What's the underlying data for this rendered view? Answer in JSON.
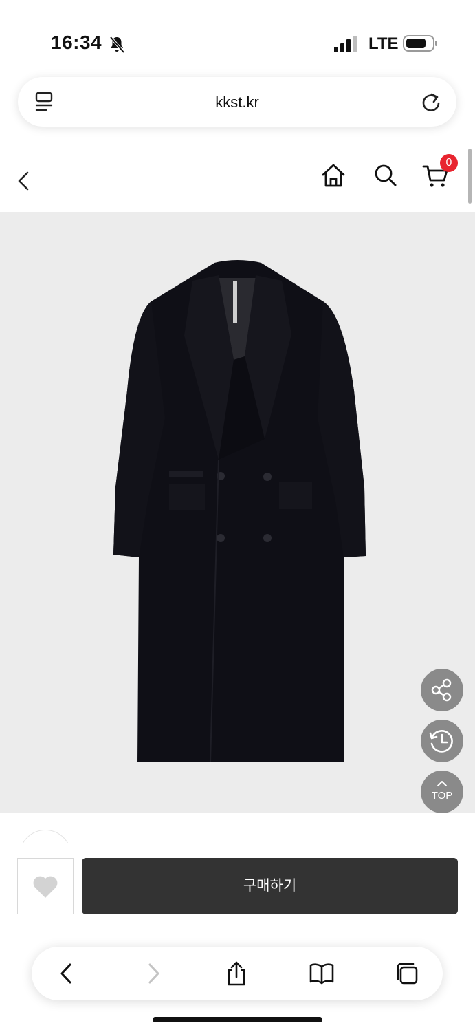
{
  "status_bar": {
    "time": "16:34",
    "network": "LTE"
  },
  "browser": {
    "url": "kkst.kr"
  },
  "header": {
    "cart_count": "0"
  },
  "floating": {
    "top_label": "TOP"
  },
  "bottom": {
    "buy_label": "구매하기"
  },
  "icons": {
    "status": [
      "bell-slash-icon",
      "signal-icon",
      "battery-icon"
    ],
    "url_bar": [
      "reader-icon",
      "reload-icon"
    ],
    "header": [
      "back-icon",
      "home-icon",
      "search-icon",
      "cart-icon"
    ],
    "floating": [
      "share-icon",
      "recent-history-icon",
      "arrow-up-icon"
    ],
    "bottom": [
      "heart-icon"
    ],
    "toolbar": [
      "back-arrow-icon",
      "forward-arrow-icon",
      "share-icon",
      "book-icon",
      "tabs-icon"
    ]
  },
  "colors": {
    "badge": "#e8242f",
    "buy_button": "#333333",
    "image_bg": "#ececec",
    "fab": "#8a8a8a"
  }
}
